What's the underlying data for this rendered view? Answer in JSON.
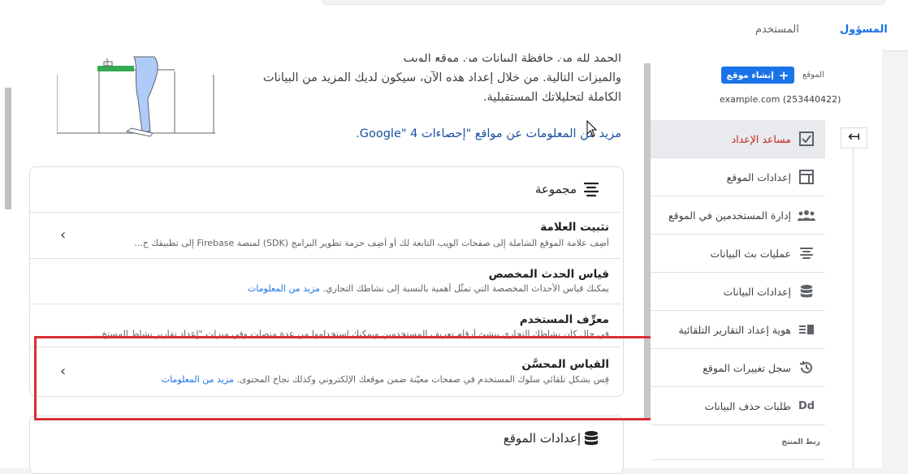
{
  "tabs": {
    "admin": "المسؤول",
    "user": "المستخدم"
  },
  "intro": {
    "line_cut": "الحمد لله من حافظة البيانات من موقع الويب",
    "line1": "والميزات التالية. من خلال إعداد هذه الآن، سيكون لديك المزيد من البيانات",
    "line2": "الكاملة لتحليلاتك المستقبلية.",
    "learn_more": "مزيد من المعلومات عن مواقع \"إحصاءات Google\" 4."
  },
  "collection_card": {
    "header": "مجموعة",
    "rows": [
      {
        "title": "تثبيت العلامة",
        "desc": "أضِف علامة الموقع الشاملة إلى صفحات الويب التابعة لك أو أضِف حزمة تطوير البرامج (SDK) لمنصة Firebase إلى تطبيقك ح...",
        "link": ""
      },
      {
        "title": "قياس الحدث المخصص",
        "desc": "يمكنك قياس الأحداث المخصصة التي تمثّل أهمية بالنسبة إلى نشاطك التجاري.",
        "link": "مزيد من المعلومات"
      },
      {
        "title": "معرِّف المستخدم",
        "desc": "في حال كان نشاطك التجاري ينشئ أرقام تعريف المستخدمين ويمكنك استخدامها من عدة منصات وفي ميزات \"إعداد تقارير نشاط المستخ...",
        "link": ""
      },
      {
        "title": "القياس المحسَّن",
        "desc": "قِس بشكلٍ تلقائي سلوك المستخدم في صفحات معيّنة ضمن موقعك الإلكتروني وكذلك نجاح المحتوى.",
        "link": "مزيد من المعلومات"
      }
    ]
  },
  "property_settings_card": {
    "header": "إعدادات الموقع"
  },
  "right_panel": {
    "property_label": "الموقع",
    "create_button": "إنشاء موقع",
    "property_name": "example.com (253440422)",
    "nav": [
      {
        "label": "مساعد الإعداد",
        "icon": "checklist-icon",
        "active": true
      },
      {
        "label": "إعدادات الموقع",
        "icon": "property-settings-icon"
      },
      {
        "label": "إدارة المستخدمين في الموقع",
        "icon": "users-icon"
      },
      {
        "label": "عمليات بث البيانات",
        "icon": "data-streams-icon"
      },
      {
        "label": "إعدادات البيانات",
        "icon": "database-icon"
      },
      {
        "label": "هوية إعداد التقارير التلقائية",
        "icon": "reporting-identity-icon"
      },
      {
        "label": "سجل تغييرات الموقع",
        "icon": "history-icon"
      },
      {
        "label": "طلبات حذف البيانات",
        "icon": "data-deletion-icon"
      }
    ],
    "product_links_label": "ربط المنتج"
  },
  "colors": {
    "accent": "#1a73e8",
    "active_red": "#c5221f",
    "highlight_box": "#d93035"
  }
}
